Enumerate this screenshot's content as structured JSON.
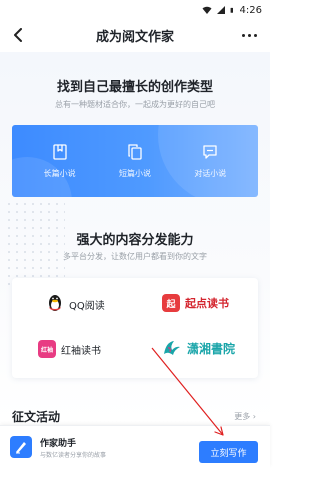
{
  "status_bar": {
    "time": "4:26"
  },
  "nav": {
    "title": "成为阅文作家"
  },
  "section_types": {
    "title": "找到自己最擅长的创作类型",
    "subtitle": "总有一种题材适合你，一起成为更好的自己吧",
    "items": [
      {
        "label": "长篇小说",
        "icon": "bookmark-book-icon"
      },
      {
        "label": "短篇小说",
        "icon": "copy-pages-icon"
      },
      {
        "label": "对话小说",
        "icon": "chat-bubble-icon"
      }
    ]
  },
  "section_platforms": {
    "title": "强大的内容分发能力",
    "subtitle": "多平台分发，让数亿用户都看到你的文字",
    "platforms": [
      {
        "name": "QQ阅读",
        "logo": "qq-penguin-logo"
      },
      {
        "name": "起点读书",
        "logo_text": "起",
        "logo": "qidian-logo"
      },
      {
        "name": "红袖读书",
        "logo_text": "红袖",
        "logo": "hongxiu-logo"
      },
      {
        "name": "潇湘書院",
        "logo": "xiaoxiang-logo"
      }
    ]
  },
  "section_contest": {
    "title": "征文活动",
    "more": "更多 ›"
  },
  "bottom_bar": {
    "app_name": "作家助手",
    "app_desc": "与数亿读者分享你的故事",
    "button": "立刻写作"
  },
  "colors": {
    "primary": "#2d7dff",
    "card_gradient_start": "#3d8bff",
    "card_gradient_end": "#79b1ff",
    "annotation_arrow": "#e02020",
    "qidian_red": "#d4262f",
    "hongxiu_pink": "#e83c83",
    "xiaoxiang_teal": "#19a5a9"
  }
}
